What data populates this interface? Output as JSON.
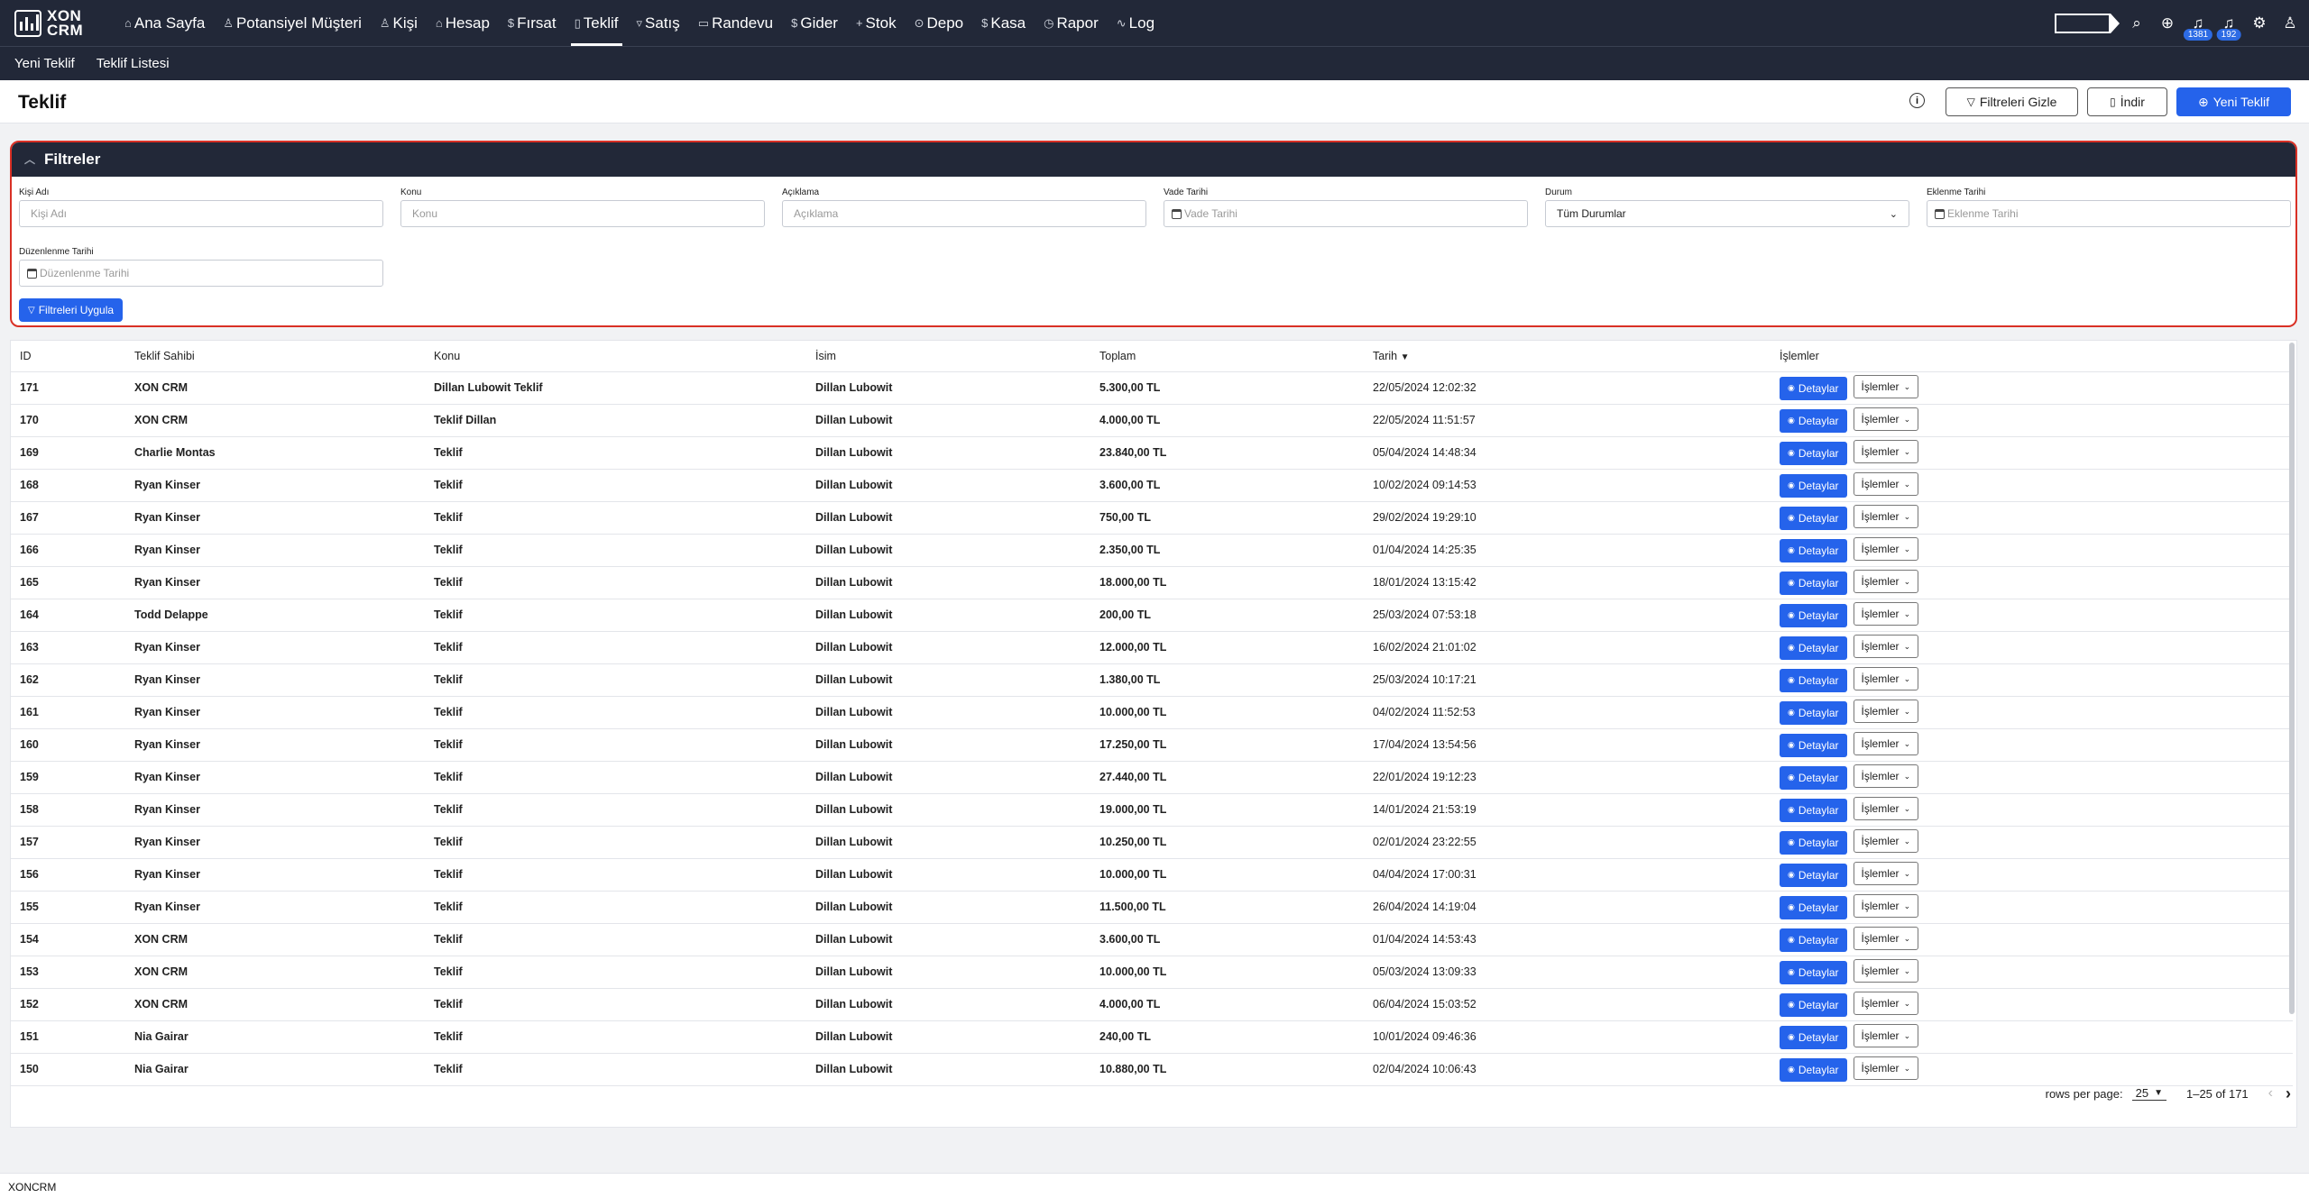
{
  "app": {
    "logo_line1": "XON",
    "logo_line2": "CRM"
  },
  "nav": [
    {
      "icon": "⌂",
      "label": "Ana Sayfa"
    },
    {
      "icon": "♙",
      "label": "Potansiyel Müşteri"
    },
    {
      "icon": "♙",
      "label": "Kişi"
    },
    {
      "icon": "⌂",
      "label": "Hesap"
    },
    {
      "icon": "$",
      "label": "Fırsat"
    },
    {
      "icon": "▯",
      "label": "Teklif"
    },
    {
      "icon": "▿",
      "label": "Satış"
    },
    {
      "icon": "▭",
      "label": "Randevu"
    },
    {
      "icon": "$",
      "label": "Gider"
    },
    {
      "icon": "+",
      "label": "Stok"
    },
    {
      "icon": "⊙",
      "label": "Depo"
    },
    {
      "icon": "$",
      "label": "Kasa"
    },
    {
      "icon": "◷",
      "label": "Rapor"
    },
    {
      "icon": "∿",
      "label": "Log"
    }
  ],
  "top_icons": {
    "notif_count_1": "1381",
    "notif_count_2": "192"
  },
  "subnav": {
    "new": "Yeni Teklif",
    "list": "Teklif Listesi"
  },
  "page": {
    "title": "Teklif",
    "hide_filters": "Filtreleri Gizle",
    "download": "İndir",
    "new_offer": "Yeni Teklif"
  },
  "filters": {
    "title": "Filtreler",
    "apply": "Filtreleri Uygula",
    "fields": {
      "kisi": {
        "label": "Kişi Adı",
        "placeholder": "Kişi Adı"
      },
      "konu": {
        "label": "Konu",
        "placeholder": "Konu"
      },
      "aciklama": {
        "label": "Açıklama",
        "placeholder": "Açıklama"
      },
      "vade": {
        "label": "Vade Tarihi",
        "placeholder": "Vade Tarihi"
      },
      "durum": {
        "label": "Durum",
        "value": "Tüm Durumlar"
      },
      "eklenme": {
        "label": "Eklenme Tarihi",
        "placeholder": "Eklenme Tarihi"
      },
      "duzenlenme": {
        "label": "Düzenlenme Tarihi",
        "placeholder": "Düzenlenme Tarihi"
      }
    }
  },
  "table": {
    "columns": [
      "ID",
      "Teklif Sahibi",
      "Konu",
      "İsim",
      "Toplam",
      "Tarih",
      "İşlemler"
    ],
    "detail_label": "Detaylar",
    "ops_label": "İşlemler",
    "rows": [
      [
        "171",
        "XON CRM",
        "Dillan Lubowit Teklif",
        "Dillan Lubowit",
        "5.300,00 TL",
        "22/05/2024 12:02:32"
      ],
      [
        "170",
        "XON CRM",
        "Teklif Dillan",
        "Dillan Lubowit",
        "4.000,00 TL",
        "22/05/2024 11:51:57"
      ],
      [
        "169",
        "Charlie Montas",
        "Teklif",
        "Dillan Lubowit",
        "23.840,00 TL",
        "05/04/2024 14:48:34"
      ],
      [
        "168",
        "Ryan Kinser",
        "Teklif",
        "Dillan Lubowit",
        "3.600,00 TL",
        "10/02/2024 09:14:53"
      ],
      [
        "167",
        "Ryan Kinser",
        "Teklif",
        "Dillan Lubowit",
        "750,00 TL",
        "29/02/2024 19:29:10"
      ],
      [
        "166",
        "Ryan Kinser",
        "Teklif",
        "Dillan Lubowit",
        "2.350,00 TL",
        "01/04/2024 14:25:35"
      ],
      [
        "165",
        "Ryan Kinser",
        "Teklif",
        "Dillan Lubowit",
        "18.000,00 TL",
        "18/01/2024 13:15:42"
      ],
      [
        "164",
        "Todd Delappe",
        "Teklif",
        "Dillan Lubowit",
        "200,00 TL",
        "25/03/2024 07:53:18"
      ],
      [
        "163",
        "Ryan Kinser",
        "Teklif",
        "Dillan Lubowit",
        "12.000,00 TL",
        "16/02/2024 21:01:02"
      ],
      [
        "162",
        "Ryan Kinser",
        "Teklif",
        "Dillan Lubowit",
        "1.380,00 TL",
        "25/03/2024 10:17:21"
      ],
      [
        "161",
        "Ryan Kinser",
        "Teklif",
        "Dillan Lubowit",
        "10.000,00 TL",
        "04/02/2024 11:52:53"
      ],
      [
        "160",
        "Ryan Kinser",
        "Teklif",
        "Dillan Lubowit",
        "17.250,00 TL",
        "17/04/2024 13:54:56"
      ],
      [
        "159",
        "Ryan Kinser",
        "Teklif",
        "Dillan Lubowit",
        "27.440,00 TL",
        "22/01/2024 19:12:23"
      ],
      [
        "158",
        "Ryan Kinser",
        "Teklif",
        "Dillan Lubowit",
        "19.000,00 TL",
        "14/01/2024 21:53:19"
      ],
      [
        "157",
        "Ryan Kinser",
        "Teklif",
        "Dillan Lubowit",
        "10.250,00 TL",
        "02/01/2024 23:22:55"
      ],
      [
        "156",
        "Ryan Kinser",
        "Teklif",
        "Dillan Lubowit",
        "10.000,00 TL",
        "04/04/2024 17:00:31"
      ],
      [
        "155",
        "Ryan Kinser",
        "Teklif",
        "Dillan Lubowit",
        "11.500,00 TL",
        "26/04/2024 14:19:04"
      ],
      [
        "154",
        "XON CRM",
        "Teklif",
        "Dillan Lubowit",
        "3.600,00 TL",
        "01/04/2024 14:53:43"
      ],
      [
        "153",
        "XON CRM",
        "Teklif",
        "Dillan Lubowit",
        "10.000,00 TL",
        "05/03/2024 13:09:33"
      ],
      [
        "152",
        "XON CRM",
        "Teklif",
        "Dillan Lubowit",
        "4.000,00 TL",
        "06/04/2024 15:03:52"
      ],
      [
        "151",
        "Nia Gairar",
        "Teklif",
        "Dillan Lubowit",
        "240,00 TL",
        "10/01/2024 09:46:36"
      ],
      [
        "150",
        "Nia Gairar",
        "Teklif",
        "Dillan Lubowit",
        "10.880,00 TL",
        "02/04/2024 10:06:43"
      ]
    ]
  },
  "pager": {
    "rows_per_page_label": "rows per page:",
    "rows_per_page": "25",
    "range": "1–25 of 171"
  },
  "footer": {
    "text": "XONCRM"
  },
  "colors": {
    "navbar": "#222838",
    "primary": "#2563eb",
    "filter_border": "#d93025"
  }
}
